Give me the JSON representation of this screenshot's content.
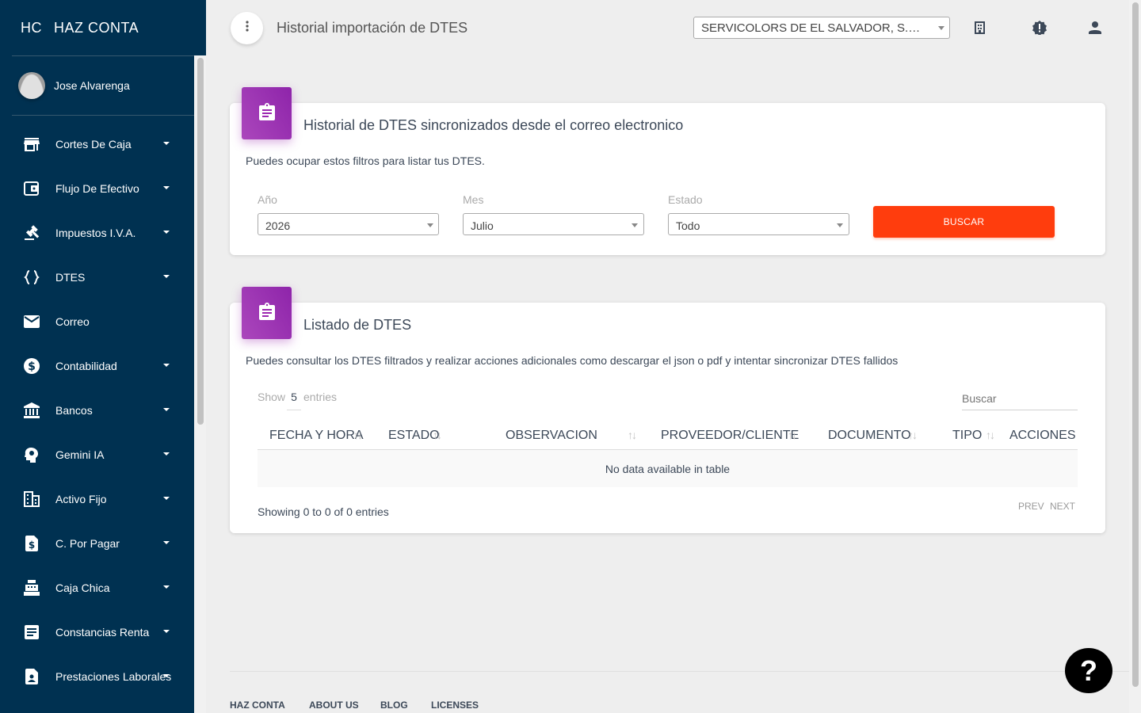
{
  "brand": {
    "mini": "HC",
    "name": "HAZ CONTA"
  },
  "user": {
    "name": "Jose Alvarenga"
  },
  "sidebar": {
    "items": [
      {
        "label": "Cortes De Caja",
        "icon": "store-icon",
        "has_caret": true
      },
      {
        "label": "Flujo De Efectivo",
        "icon": "wallet-icon",
        "has_caret": true
      },
      {
        "label": "Impuestos I.V.A.",
        "icon": "gavel-icon",
        "has_caret": true
      },
      {
        "label": "DTES",
        "icon": "code-braces-icon",
        "has_caret": true
      },
      {
        "label": "Correo",
        "icon": "mail-icon",
        "has_caret": false
      },
      {
        "label": "Contabilidad",
        "icon": "dollar-circle-icon",
        "has_caret": true
      },
      {
        "label": "Bancos",
        "icon": "bank-icon",
        "has_caret": true
      },
      {
        "label": "Gemini IA",
        "icon": "psychology-icon",
        "has_caret": true
      },
      {
        "label": "Activo Fijo",
        "icon": "building-icon",
        "has_caret": true
      },
      {
        "label": "C. Por Pagar",
        "icon": "request-quote-icon",
        "has_caret": true
      },
      {
        "label": "Caja Chica",
        "icon": "cash-register-icon",
        "has_caret": true
      },
      {
        "label": "Constancias Renta",
        "icon": "article-icon",
        "has_caret": true
      },
      {
        "label": "Prestaciones Laborales",
        "icon": "badge-icon",
        "has_caret": true
      }
    ]
  },
  "header": {
    "title": "Historial importación de DTES",
    "company": "SERVICOLORS DE EL SALVADOR, S.A. DE C.V.",
    "icons": [
      "building-icon",
      "alert-badge-icon",
      "person-icon"
    ]
  },
  "filter_card": {
    "title": "Historial de DTES sincronizados desde el correo electronico",
    "description": "Puedes ocupar estos filtros para listar tus DTES.",
    "year_label": "Año",
    "year_value": "2026",
    "month_label": "Mes",
    "month_value": "Julio",
    "status_label": "Estado",
    "status_value": "Todo",
    "search_button": "BUSCAR"
  },
  "list_card": {
    "title": "Listado de DTES",
    "description": "Puedes consultar los DTES filtrados y realizar acciones adicionales como descargar el json o pdf y intentar sincronizar DTES fallidos",
    "show_label": "Show",
    "entries_value": "5",
    "entries_label": "entries",
    "search_placeholder": "Buscar",
    "columns": [
      "FECHA Y HORA",
      "ESTADO",
      "OBSERVACION",
      "PROVEEDOR/CLIENTE",
      "DOCUMENTO",
      "TIPO",
      "ACCIONES"
    ],
    "empty_message": "No data available in table",
    "info": "Showing 0 to 0 of 0 entries",
    "prev": "PREV",
    "next": "NEXT"
  },
  "footer": {
    "links": [
      "HAZ CONTA",
      "ABOUT US",
      "BLOG",
      "LICENSES"
    ]
  },
  "help": {
    "label": "?"
  },
  "colors": {
    "sidebar": "#003151",
    "accent": "#ff3d0d",
    "card_icon": "#9c27b0"
  }
}
